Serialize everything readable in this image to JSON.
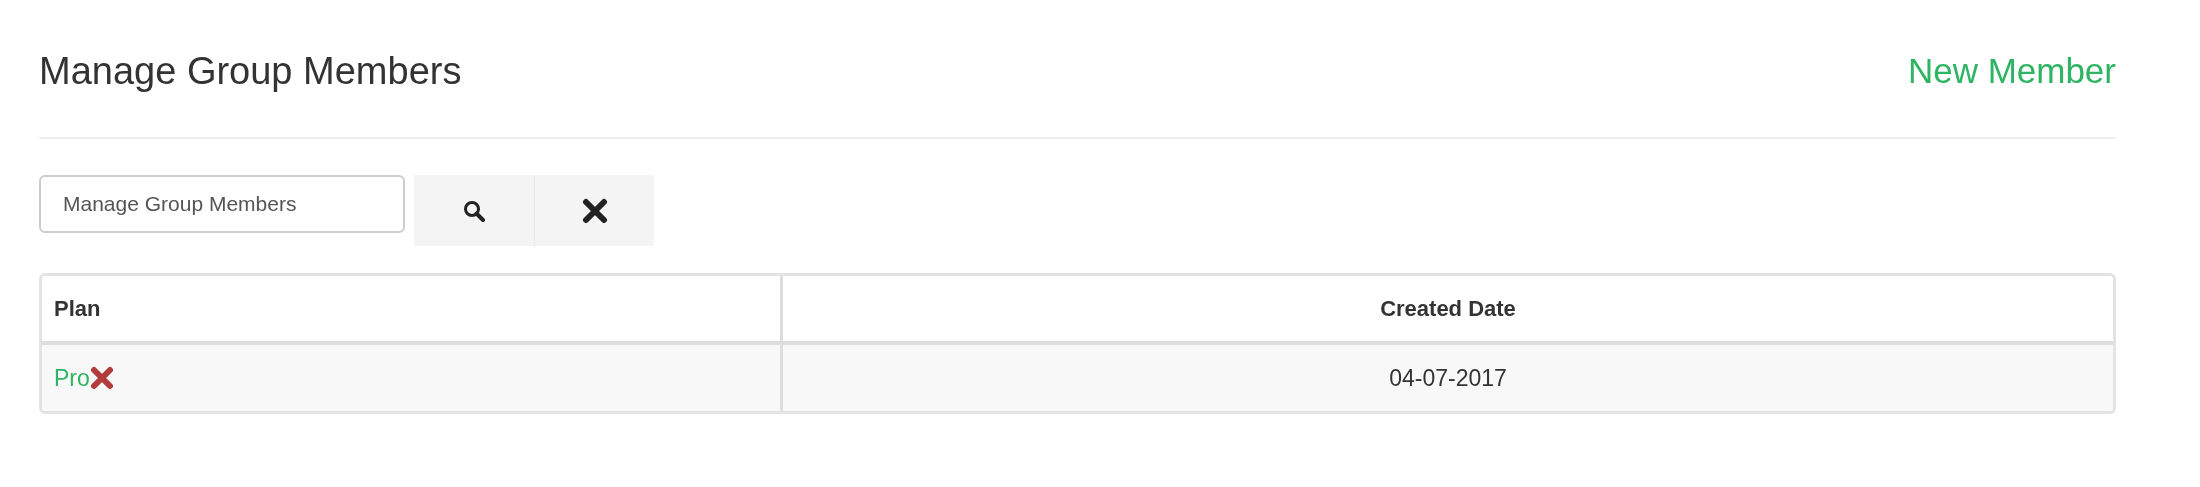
{
  "header": {
    "title": "Manage Group Members",
    "action": "New Member"
  },
  "search": {
    "value": "Manage Group Members"
  },
  "table": {
    "columns": [
      {
        "label": "Plan"
      },
      {
        "label": "Created Date"
      }
    ],
    "rows": [
      {
        "plan": "Pro",
        "created": "04-07-2017"
      }
    ]
  }
}
